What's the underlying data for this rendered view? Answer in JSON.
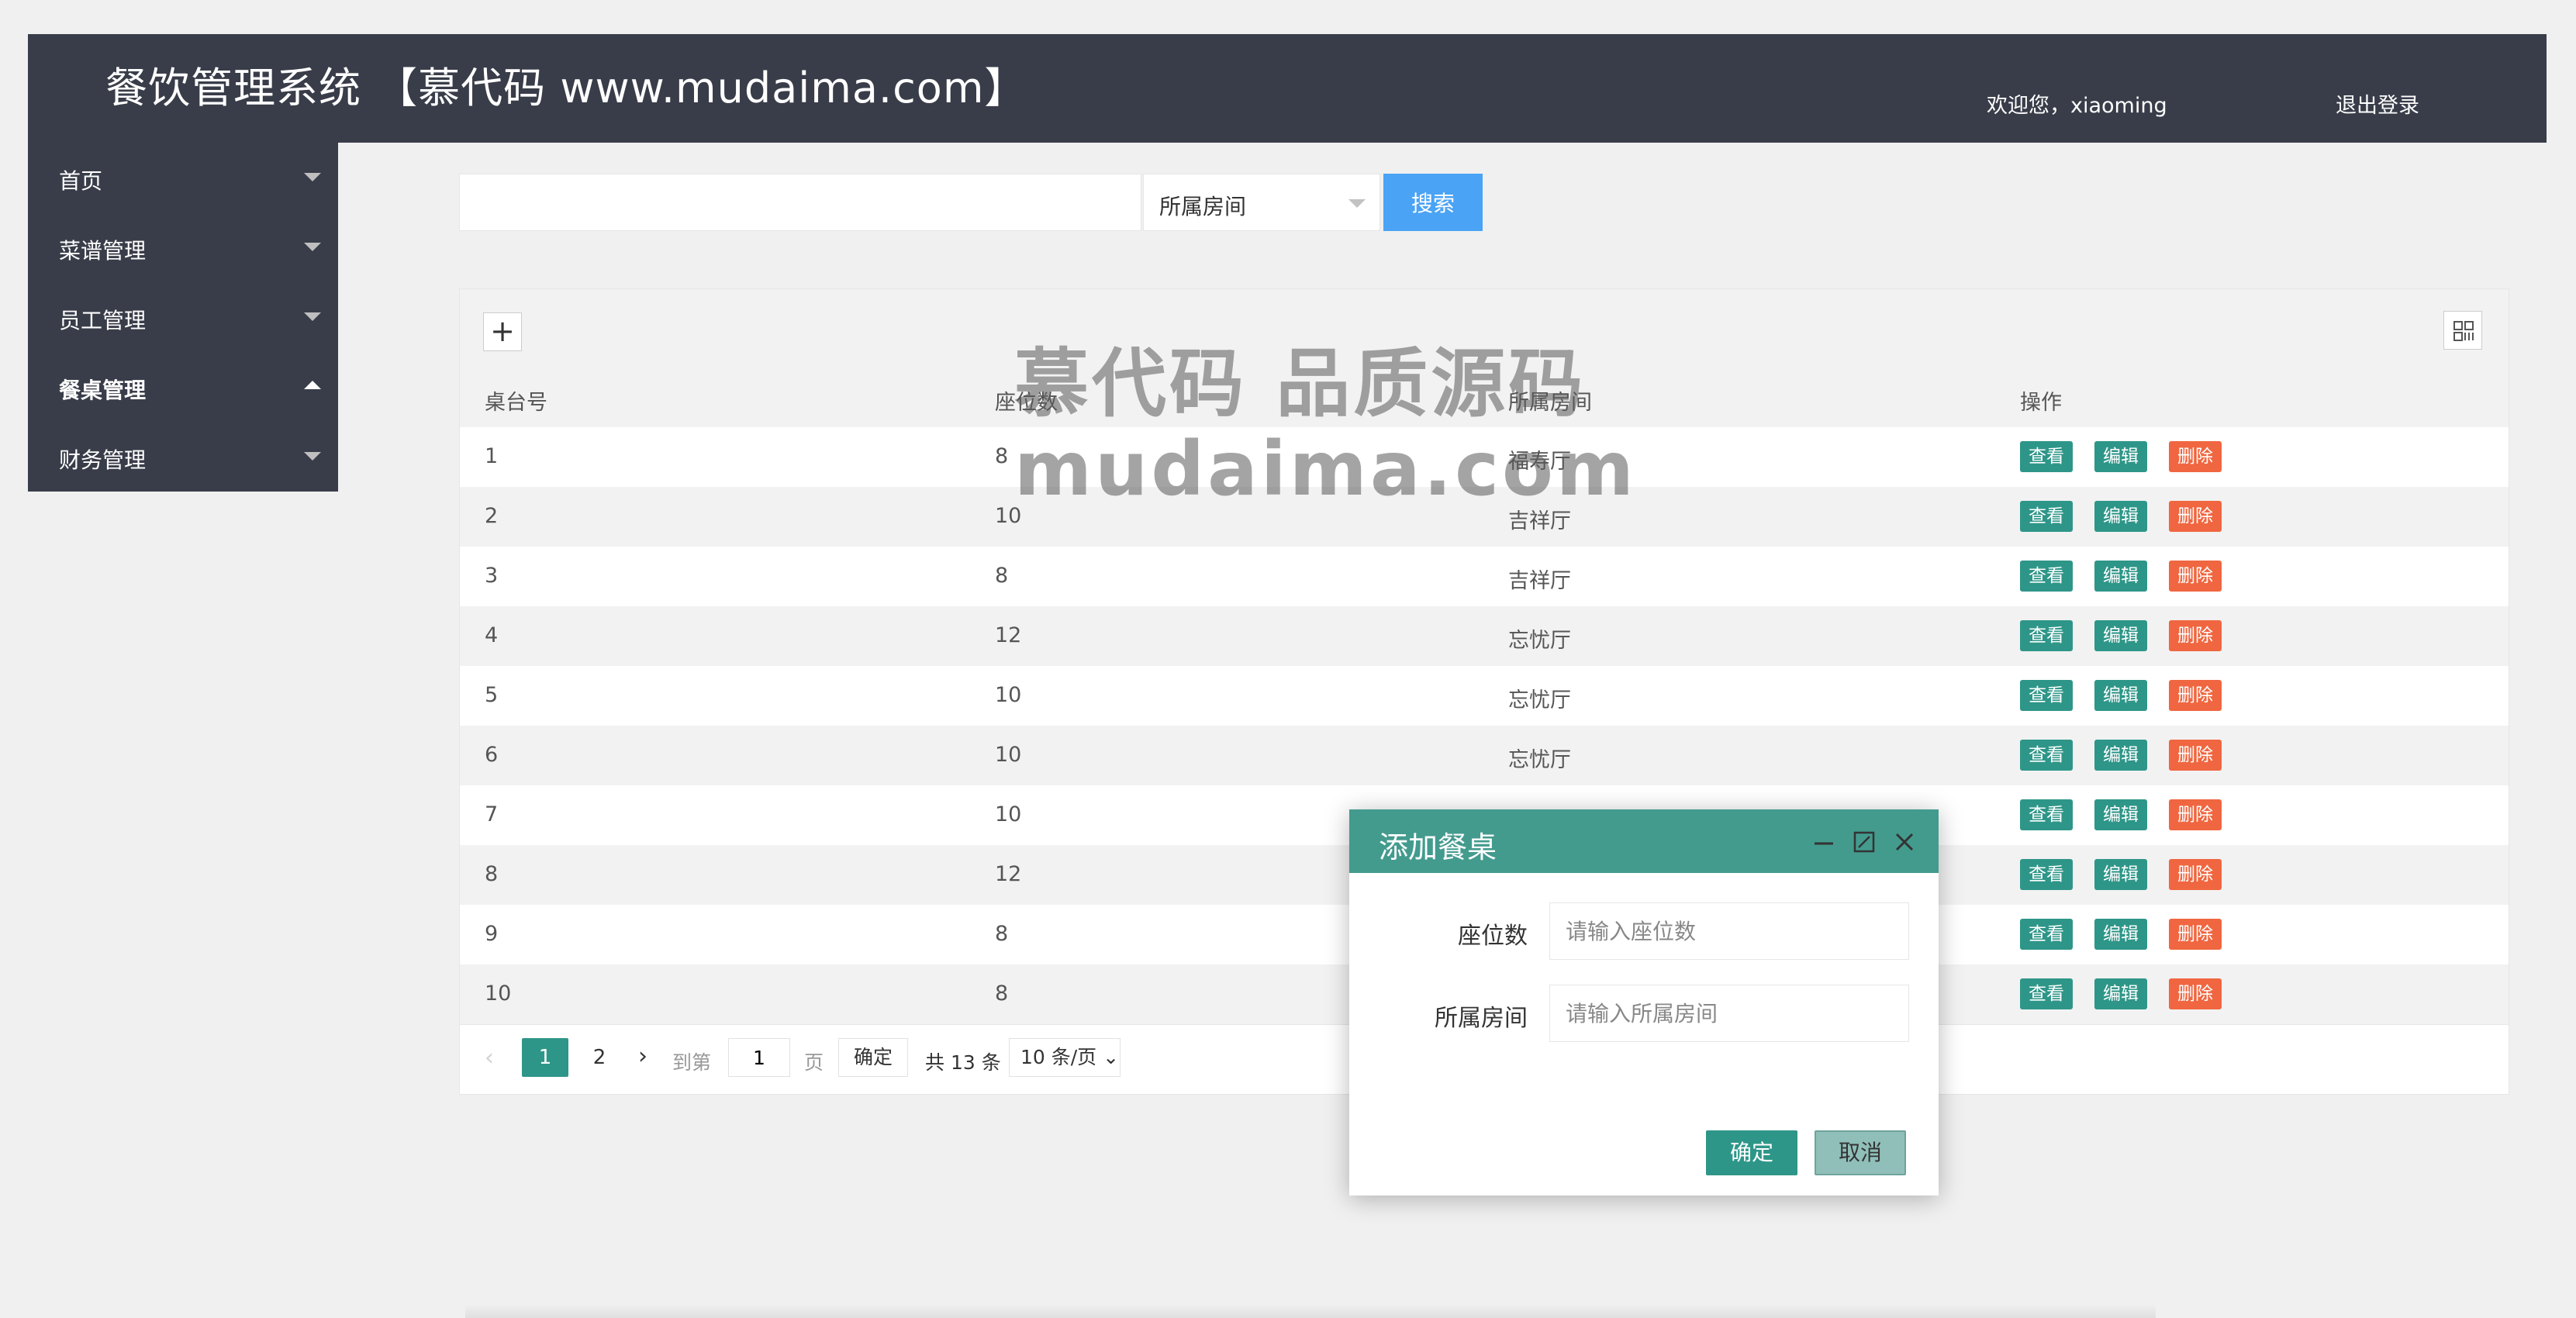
{
  "header": {
    "title": "餐饮管理系统 【慕代码 www.mudaima.com】",
    "welcome": "欢迎您，xiaoming",
    "logout": "退出登录"
  },
  "sidebar": {
    "items": [
      {
        "label": "首页",
        "active": false
      },
      {
        "label": "菜谱管理",
        "active": false
      },
      {
        "label": "员工管理",
        "active": false
      },
      {
        "label": "餐桌管理",
        "active": true
      },
      {
        "label": "财务管理",
        "active": false
      }
    ]
  },
  "search": {
    "input_value": "",
    "select_value": "所属房间",
    "button": "搜索"
  },
  "toolbar": {
    "add": "+"
  },
  "table": {
    "columns": [
      "桌台号",
      "座位数",
      "所属房间",
      "操作"
    ],
    "actions": {
      "view": "查看",
      "edit": "编辑",
      "delete": "删除"
    },
    "rows": [
      {
        "id": "1",
        "seats": "8",
        "room": "福寿厅"
      },
      {
        "id": "2",
        "seats": "10",
        "room": "吉祥厅"
      },
      {
        "id": "3",
        "seats": "8",
        "room": "吉祥厅"
      },
      {
        "id": "4",
        "seats": "12",
        "room": "忘忧厅"
      },
      {
        "id": "5",
        "seats": "10",
        "room": "忘忧厅"
      },
      {
        "id": "6",
        "seats": "10",
        "room": "忘忧厅"
      },
      {
        "id": "7",
        "seats": "10",
        "room": ""
      },
      {
        "id": "8",
        "seats": "12",
        "room": ""
      },
      {
        "id": "9",
        "seats": "8",
        "room": ""
      },
      {
        "id": "10",
        "seats": "8",
        "room": ""
      }
    ]
  },
  "pager": {
    "prev": "‹",
    "page1": "1",
    "page2": "2",
    "next": "›",
    "goto": "到第",
    "page_input": "1",
    "page_word": "页",
    "confirm": "确定",
    "total": "共 13 条",
    "page_size": "10 条/页"
  },
  "watermark": {
    "line1": "慕代码 品质源码",
    "line2": "mudaima.com"
  },
  "dialog": {
    "title": "添加餐桌",
    "fields": [
      {
        "label": "座位数",
        "placeholder": "请输入座位数"
      },
      {
        "label": "所属房间",
        "placeholder": "请输入所属房间"
      }
    ],
    "ok": "确定",
    "cancel": "取消"
  },
  "colors": {
    "header_bg": "#393d49",
    "primary": "#2e9688",
    "danger": "#f06640",
    "search_blue": "#4aa3f5",
    "dialog_head": "#439b8e"
  }
}
